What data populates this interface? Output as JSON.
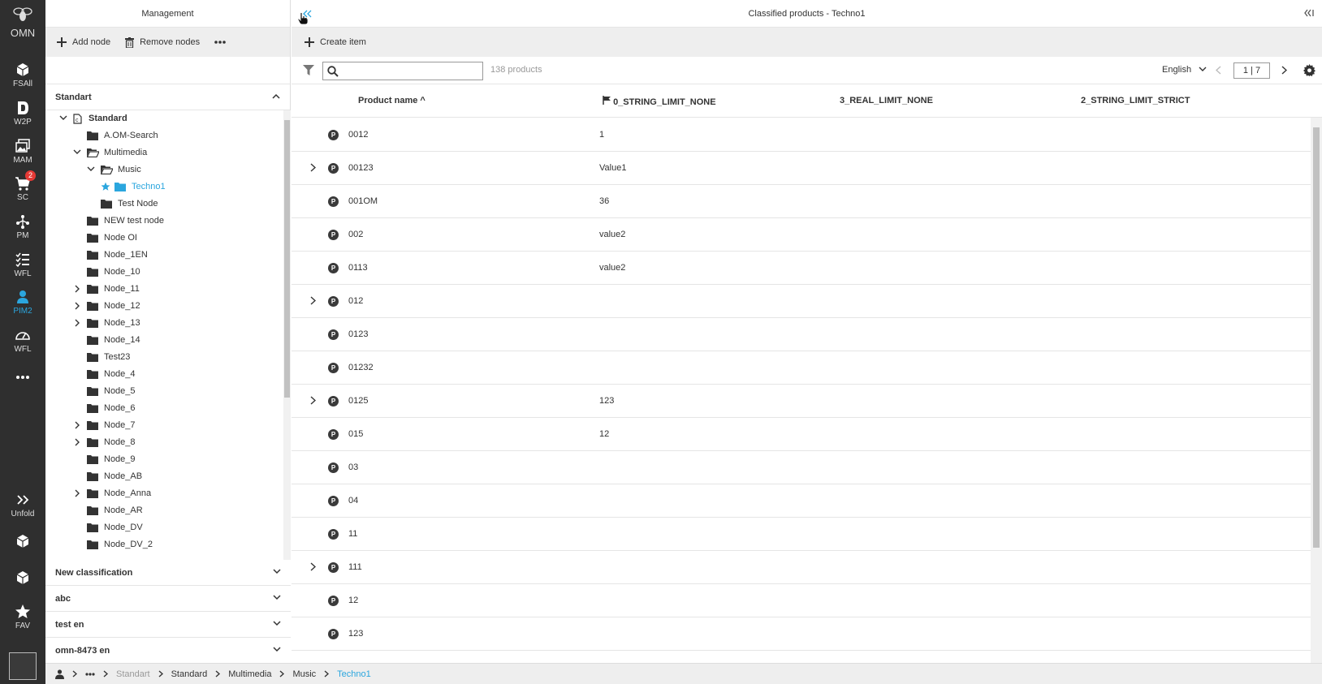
{
  "rail": {
    "logo_text": "OMN",
    "items": [
      {
        "label": "FSAll",
        "icon": "cube-icon"
      },
      {
        "label": "W2P",
        "icon": "w2p-icon"
      },
      {
        "label": "MAM",
        "icon": "images-icon"
      },
      {
        "label": "SC",
        "icon": "cart-icon",
        "badge": "2"
      },
      {
        "label": "PM",
        "icon": "share-icon"
      },
      {
        "label": "WFL",
        "icon": "checklist-icon"
      },
      {
        "label": "PIM2",
        "icon": "pim-icon",
        "active": true
      },
      {
        "label": "WFL",
        "icon": "gauge-icon"
      },
      {
        "label": "",
        "icon": "more-icon"
      }
    ],
    "unfold_label": "Unfold",
    "fav_label": "FAV"
  },
  "management": {
    "title": "Management",
    "add_node": "Add node",
    "remove_nodes": "Remove nodes",
    "classification": "Standart",
    "tree": [
      "Standard",
      "A.OM-Search",
      "Multimedia",
      "Music",
      "Techno1",
      "Test Node",
      "NEW test node",
      "Node OI",
      "Node_1EN",
      "Node_10",
      "Node_11",
      "Node_12",
      "Node_13",
      "Node_14",
      "Test23",
      "Node_4",
      "Node_5",
      "Node_6",
      "Node_7",
      "Node_8",
      "Node_9",
      "Node_AB",
      "Node_Anna",
      "Node_AR",
      "Node_DV",
      "Node_DV_2"
    ],
    "sections": [
      "New classification",
      "abc",
      "test en",
      "omn-8473 en"
    ]
  },
  "products": {
    "title": "Classified products - Techno1",
    "create_item": "Create item",
    "search_value": "",
    "count": "138 products",
    "language": "English",
    "page": "1 | 7",
    "columns": {
      "name": "Product name",
      "sort_indicator": "^",
      "col1": "0_STRING_LIMIT_NONE",
      "col2": "3_REAL_LIMIT_NONE",
      "col3": "2_STRING_LIMIT_STRICT"
    },
    "badge_letter": "P",
    "rows": [
      {
        "name": "0012",
        "c1": "1",
        "expandable": false
      },
      {
        "name": "00123",
        "c1": "Value1",
        "expandable": true
      },
      {
        "name": "001OM",
        "c1": "36",
        "expandable": false
      },
      {
        "name": "002",
        "c1": "value2",
        "expandable": false
      },
      {
        "name": "0113",
        "c1": "value2",
        "expandable": false
      },
      {
        "name": "012",
        "c1": "",
        "expandable": true
      },
      {
        "name": "0123",
        "c1": "",
        "expandable": false
      },
      {
        "name": "01232",
        "c1": "",
        "expandable": false
      },
      {
        "name": "0125",
        "c1": "123",
        "expandable": true
      },
      {
        "name": "015",
        "c1": "12",
        "expandable": false
      },
      {
        "name": "03",
        "c1": "",
        "expandable": false
      },
      {
        "name": "04",
        "c1": "",
        "expandable": false
      },
      {
        "name": "11",
        "c1": "",
        "expandable": false
      },
      {
        "name": "111",
        "c1": "",
        "expandable": true
      },
      {
        "name": "12",
        "c1": "",
        "expandable": false
      },
      {
        "name": "123",
        "c1": "",
        "expandable": false
      }
    ]
  },
  "breadcrumb": [
    "Standart",
    "Standard",
    "Multimedia",
    "Music",
    "Techno1"
  ],
  "colors": {
    "accent": "#2ba6de",
    "rail": "#2f2f2f",
    "toolbar": "#eeeeee",
    "badge": "#e53935"
  }
}
